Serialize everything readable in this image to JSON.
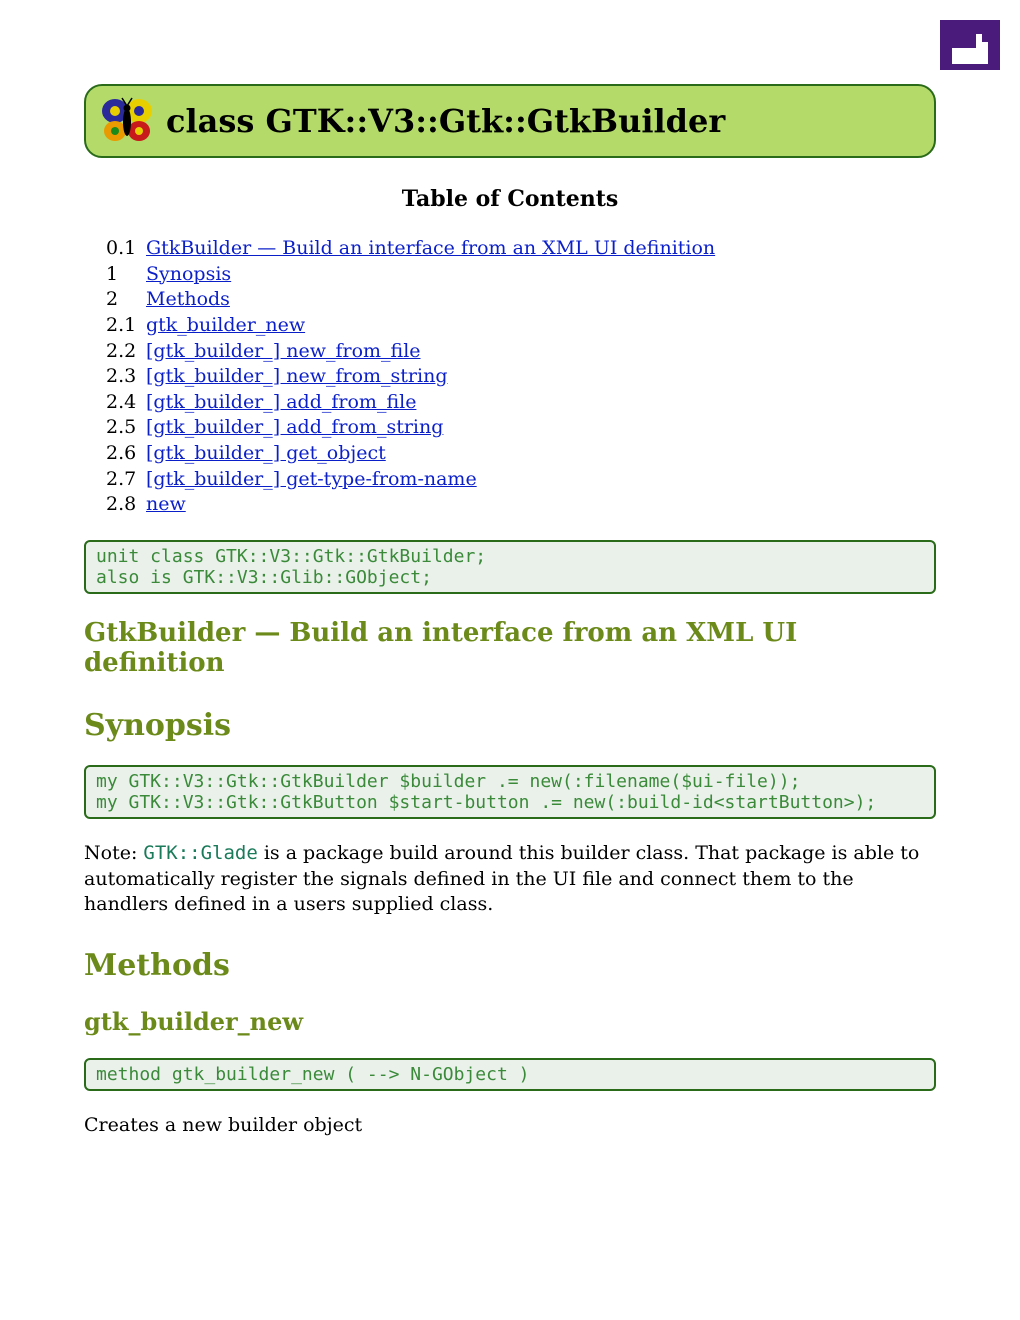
{
  "header": {
    "title": "class GTK::V3::Gtk::GtkBuilder"
  },
  "toc": {
    "title": "Table of Contents",
    "items": [
      {
        "num": "0.1",
        "label": "GtkBuilder — Build an interface from an XML UI definition"
      },
      {
        "num": "1",
        "label": "Synopsis"
      },
      {
        "num": "2",
        "label": "Methods"
      },
      {
        "num": "2.1",
        "label": "gtk_builder_new"
      },
      {
        "num": "2.2",
        "label": "[gtk_builder_] new_from_file"
      },
      {
        "num": "2.3",
        "label": "[gtk_builder_] new_from_string"
      },
      {
        "num": "2.4",
        "label": "[gtk_builder_] add_from_file"
      },
      {
        "num": "2.5",
        "label": "[gtk_builder_] add_from_string"
      },
      {
        "num": "2.6",
        "label": "[gtk_builder_] get_object"
      },
      {
        "num": "2.7",
        "label": "[gtk_builder_] get-type-from-name"
      },
      {
        "num": "2.8",
        "label": "new"
      }
    ]
  },
  "code": {
    "unit": "unit class GTK::V3::Gtk::GtkBuilder;\nalso is GTK::V3::Glib::GObject;",
    "synopsis": "my GTK::V3::Gtk::GtkBuilder $builder .= new(:filename($ui-file));\nmy GTK::V3::Gtk::GtkButton $start-button .= new(:build-id<startButton>);",
    "gtk_builder_new": "method gtk_builder_new ( --> N-GObject )"
  },
  "sections": {
    "intro": "GtkBuilder — Build an interface from an XML UI definition",
    "synopsis": "Synopsis",
    "methods": "Methods",
    "gtk_builder_new": "gtk_builder_new"
  },
  "text": {
    "note_prefix": "Note: ",
    "note_code": "GTK::Glade",
    "note_code_display": "GTK::Glade",
    "note_rest": " is a package build around this builder class. That package is able to automatically register the signals defined in the UI file and connect them to the handlers defined in a users supplied class.",
    "creates": "Creates a new builder object"
  }
}
